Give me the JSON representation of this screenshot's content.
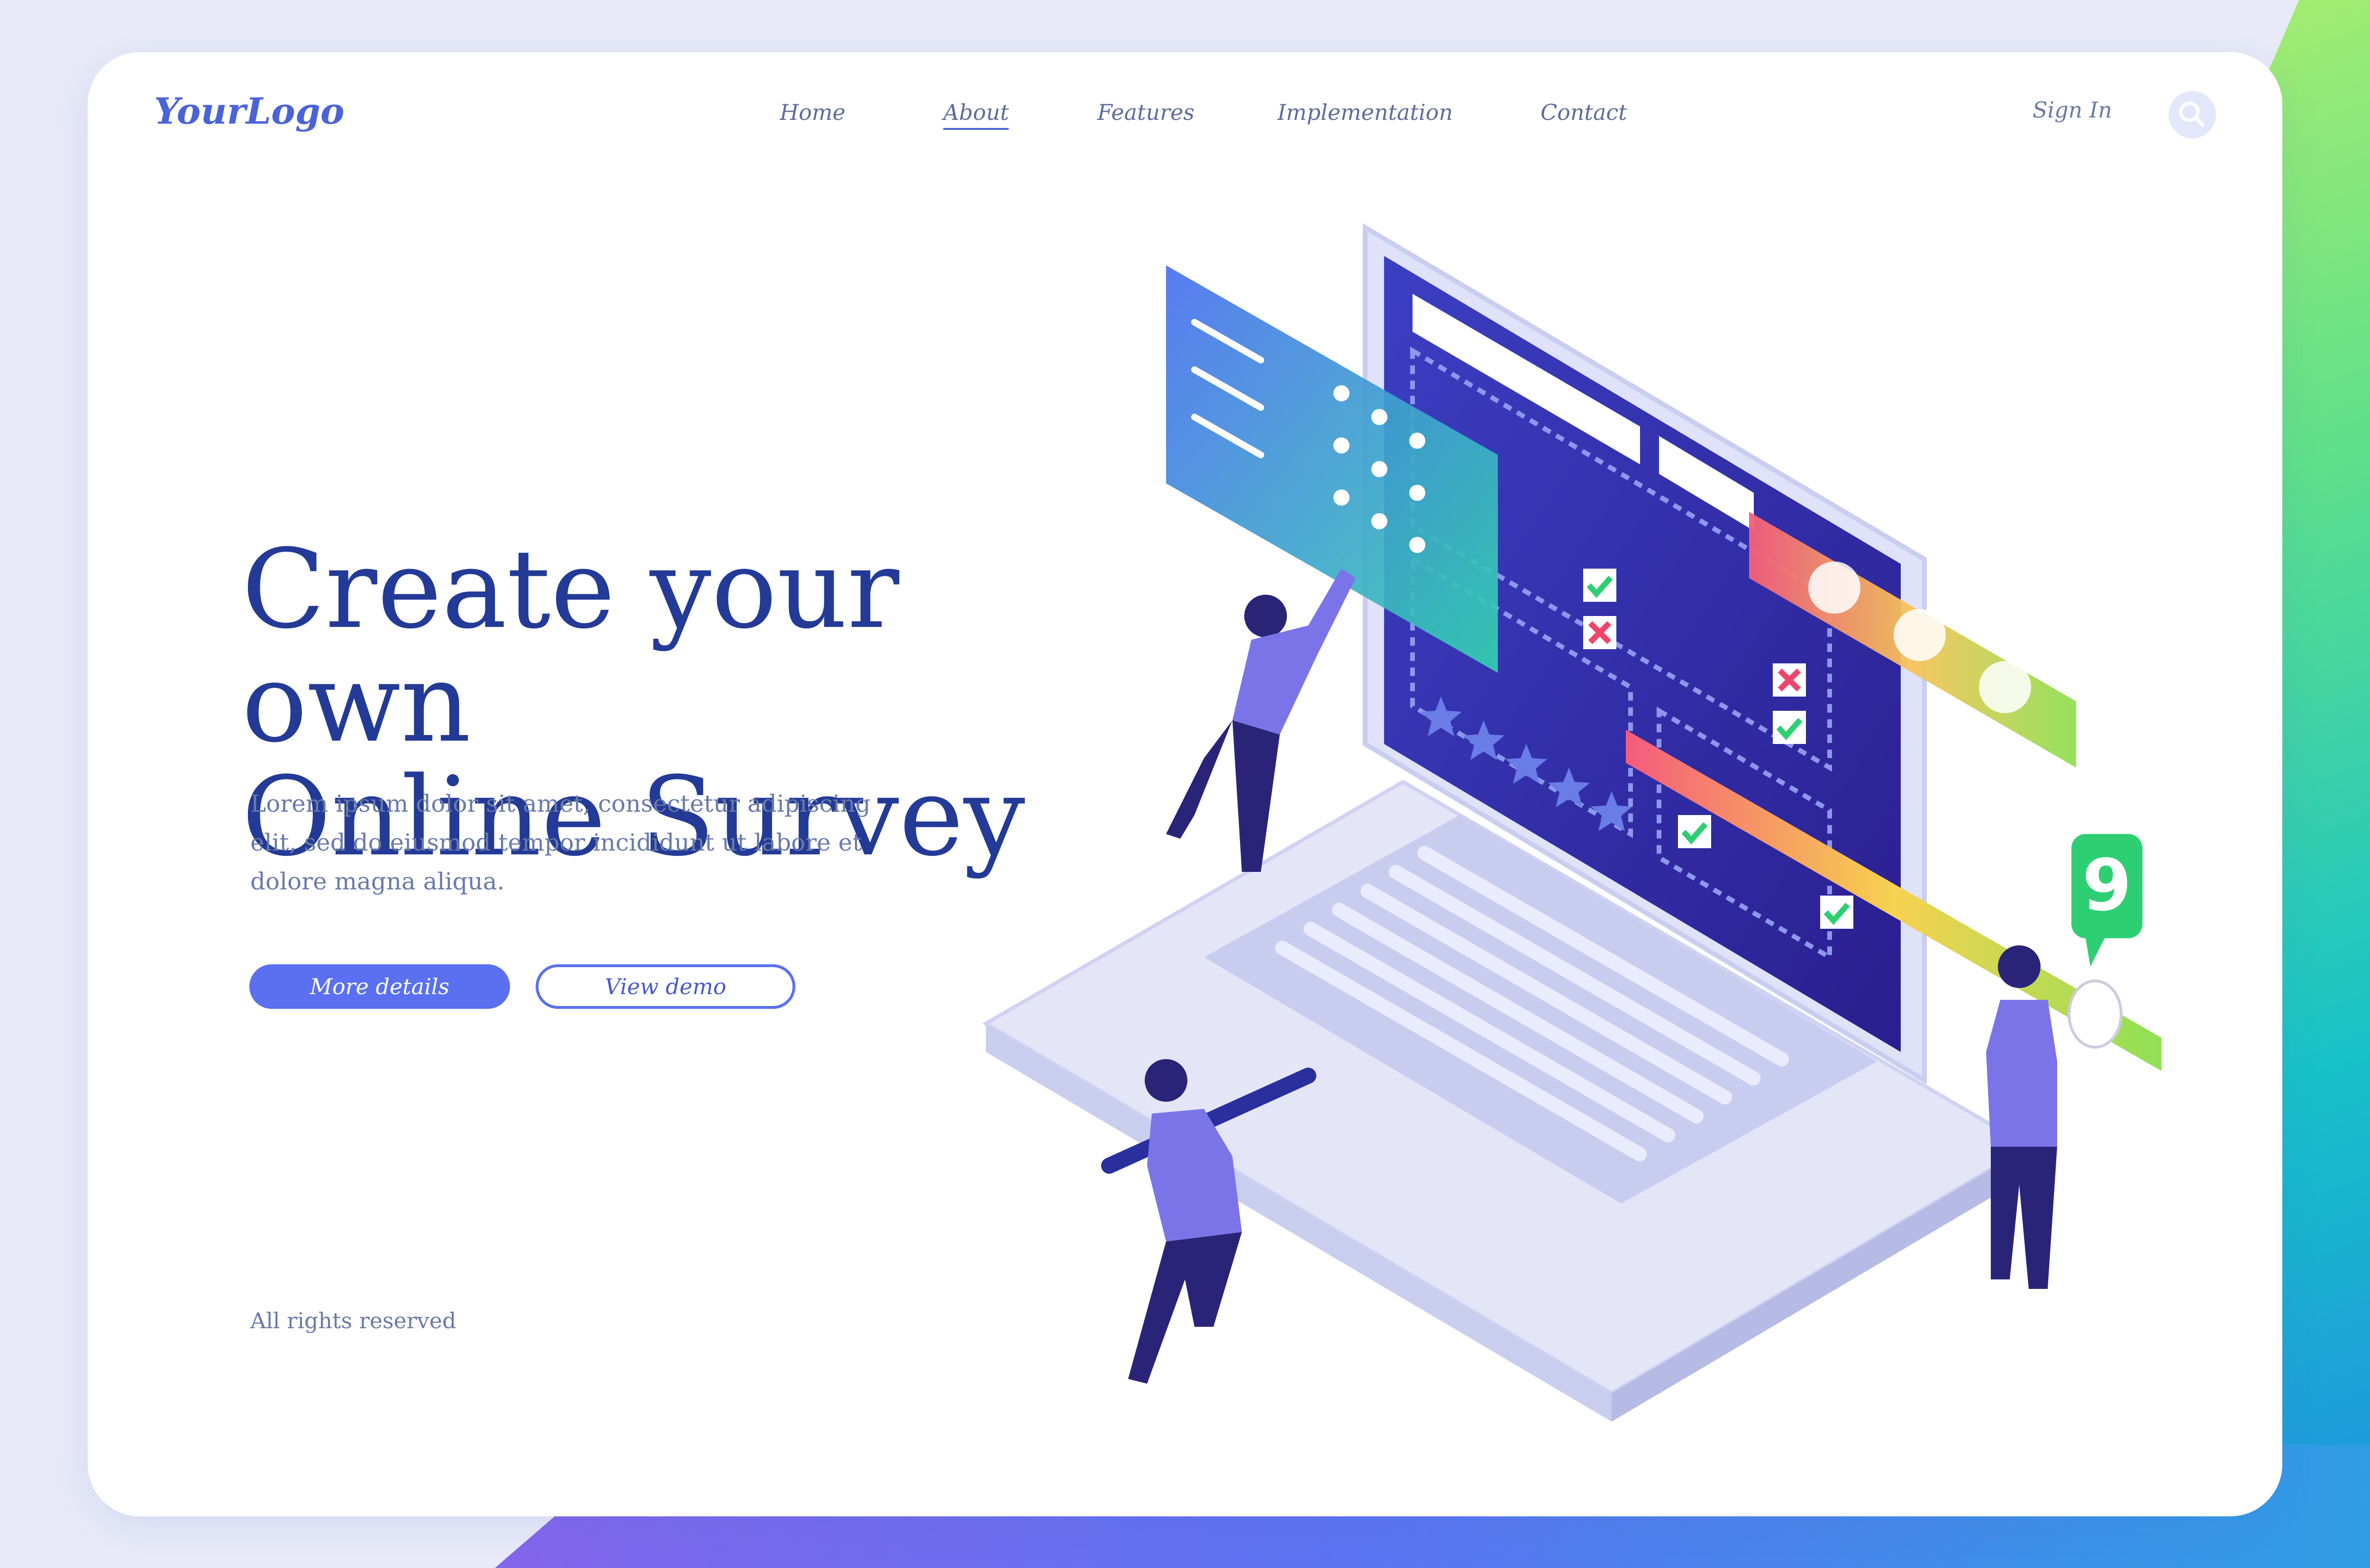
{
  "header": {
    "logo": "YourLogo",
    "nav": [
      "Home",
      "About",
      "Features",
      "Implementation",
      "Contact"
    ],
    "active_nav": "About",
    "sign_in": "Sign In",
    "search_icon": "search-icon"
  },
  "hero": {
    "title_line1": "Create your own",
    "title_line2": "Online Survey",
    "description": "Lorem ipsum dolor sit amet, consectetur adipiscing elit, sed do eiusmod tempor incididunt ut labore et dolore magna aliqua.",
    "primary_button": "More details",
    "secondary_button": "View demo"
  },
  "footer": {
    "rights": "All rights reserved"
  },
  "illustration": {
    "badge_number": "9",
    "rating_stars": 5,
    "emotions": [
      "sad-face-icon",
      "neutral-face-icon",
      "happy-face-icon"
    ]
  },
  "colors": {
    "accent": "#5a70f0",
    "headline": "#233a97",
    "screen": "#3a2fae",
    "green_badge": "#2ecf73"
  }
}
